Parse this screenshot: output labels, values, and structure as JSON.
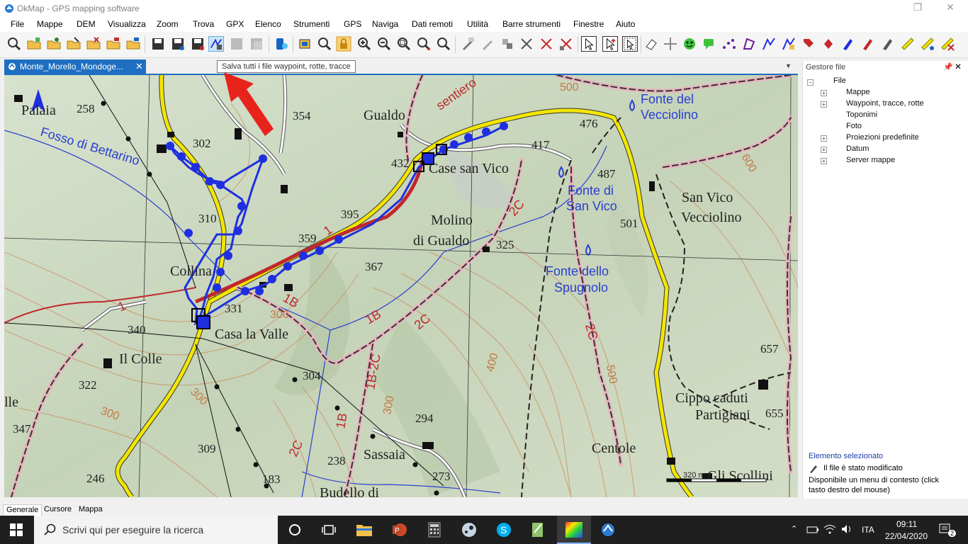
{
  "window": {
    "title": "OkMap - GPS mapping software",
    "restore": "❐",
    "close": "✕"
  },
  "menu": [
    "File",
    "Mappe",
    "DEM",
    "Visualizza",
    "Zoom",
    "Trova",
    "GPX",
    "Elenco",
    "Strumenti",
    "GPS",
    "Naviga",
    "Dati remoti",
    "Utilità",
    "Barre strumenti",
    "Finestre",
    "Aiuto"
  ],
  "tooltip": "Salva tutti i file waypoint, rotte, tracce",
  "document_tab": {
    "label": "Monte_Morello_Mondoge...",
    "close": "✕"
  },
  "map_labels": {
    "places": [
      "Palaia",
      "Gualdo",
      "Case san Vico",
      "Collina",
      "Casa la Valle",
      "Il Colle",
      "Molino",
      "di Gualdo",
      "San Vico",
      "Vecciolino",
      "Centole",
      "Sassaia",
      "Cippo caduti",
      "Partigiani",
      "Budello di",
      "Gli Scollini",
      "lle"
    ],
    "springs": [
      "Fonte del",
      "Vecciolino",
      "Fonte di",
      "San Vico",
      "Fonte dello",
      "Spugnolo"
    ],
    "elevations": [
      "258",
      "302",
      "354",
      "432",
      "417",
      "476",
      "487",
      "310",
      "395",
      "359",
      "367",
      "325",
      "501",
      "331",
      "340",
      "304",
      "322",
      "347",
      "309",
      "246",
      "238",
      "183",
      "294",
      "273",
      "657",
      "655"
    ],
    "stream": "Fosso di Bettarino",
    "trails": [
      "sentiero",
      "1",
      "1B",
      "2C",
      "1B-2C"
    ],
    "contours": [
      "300",
      "400",
      "500",
      "600"
    ],
    "scale": "320 m"
  },
  "panel": {
    "title": "Gestore file",
    "root": "File",
    "items": [
      "Mappe",
      "Waypoint, tracce, rotte",
      "Toponimi",
      "Foto",
      "Proiezioni predefinite",
      "Datum",
      "Server mappe"
    ],
    "selected_title": "Elemento selezionato",
    "modified": "Il file è stato modificato",
    "context": "Disponibile un menu di contesto (click tasto destro del mouse)"
  },
  "bottom_tabs": [
    "Generale",
    "Cursore",
    "Mappa"
  ],
  "taskbar": {
    "search": "Scrivi qui per eseguire la ricerca",
    "lang": "ITA",
    "time": "09:11",
    "date": "22/04/2020",
    "notif": "2"
  },
  "colors": {
    "accent": "#1e6fc1",
    "track": "#1f2fe0",
    "road": "#f3e600",
    "trail": "#c0272d",
    "arrow": "#e8231c"
  }
}
